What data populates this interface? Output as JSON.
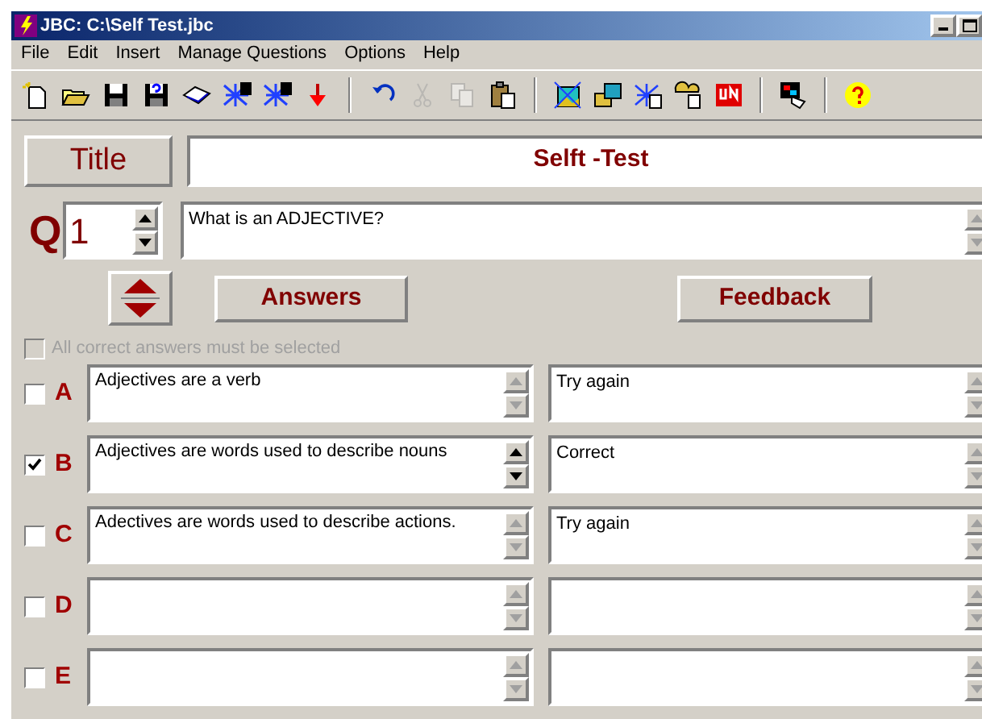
{
  "window": {
    "title": "JBC: C:\\Self Test.jbc"
  },
  "menu": [
    "File",
    "Edit",
    "Insert",
    "Manage Questions",
    "Options",
    "Help"
  ],
  "toolbar_groups": [
    [
      {
        "disabled": false
      },
      {
        "disabled": false
      },
      {
        "disabled": false
      },
      {
        "disabled": false
      },
      {
        "disabled": false
      },
      {
        "disabled": false
      },
      {
        "disabled": false
      },
      {
        "disabled": false
      }
    ],
    [
      {
        "disabled": false
      },
      {
        "disabled": true
      },
      {
        "disabled": true
      },
      {
        "disabled": false
      }
    ],
    [
      {
        "disabled": false
      },
      {
        "disabled": false
      },
      {
        "disabled": false
      },
      {
        "disabled": false
      },
      {
        "disabled": false
      }
    ],
    [
      {
        "disabled": false
      }
    ],
    [
      {
        "disabled": false
      }
    ]
  ],
  "title_button": "Title",
  "title_value": "Selft -Test",
  "question": {
    "label": "Q",
    "number": "1",
    "text": "What is an ADJECTIVE?"
  },
  "answers_button": "Answers",
  "feedback_button": "Feedback",
  "all_correct": {
    "label": "All correct answers must be selected",
    "checked": false,
    "disabled": true
  },
  "answers": [
    {
      "letter": "A",
      "checked": false,
      "text": "Adjectives are a verb",
      "feedback": "Try again",
      "scroll_enabled": false
    },
    {
      "letter": "B",
      "checked": true,
      "text": "Adjectives are words used to describe nouns",
      "feedback": "Correct",
      "scroll_enabled": true
    },
    {
      "letter": "C",
      "checked": false,
      "text": "Adectives are words used to describe actions.",
      "feedback": "Try again",
      "scroll_enabled": false
    },
    {
      "letter": "D",
      "checked": false,
      "scroll_enabled": false
    },
    {
      "letter": "E",
      "checked": false,
      "scroll_enabled": false
    }
  ]
}
